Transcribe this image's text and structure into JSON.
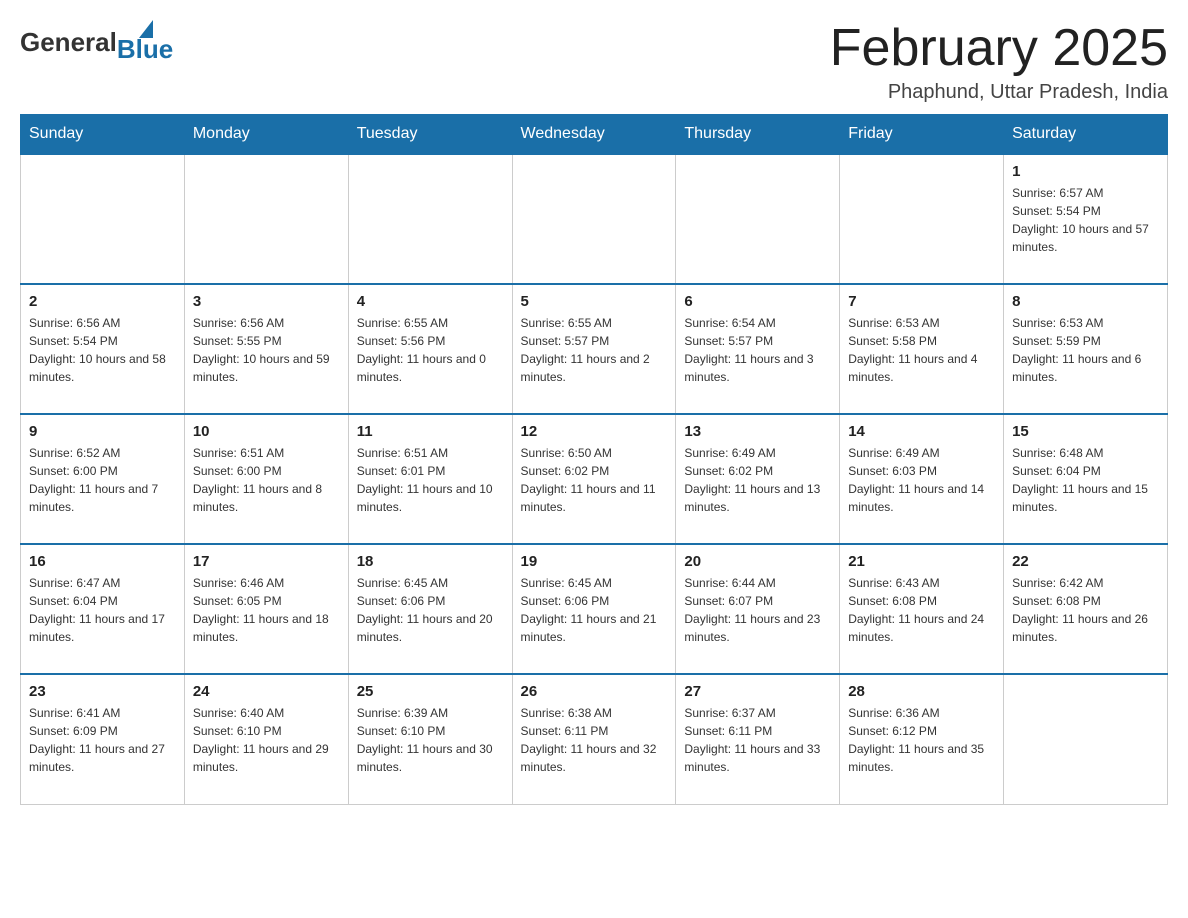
{
  "logo": {
    "general": "General",
    "blue": "Blue"
  },
  "title": {
    "month_year": "February 2025",
    "location": "Phaphund, Uttar Pradesh, India"
  },
  "days_of_week": [
    "Sunday",
    "Monday",
    "Tuesday",
    "Wednesday",
    "Thursday",
    "Friday",
    "Saturday"
  ],
  "weeks": [
    [
      {
        "day": "",
        "sunrise": "",
        "sunset": "",
        "daylight": ""
      },
      {
        "day": "",
        "sunrise": "",
        "sunset": "",
        "daylight": ""
      },
      {
        "day": "",
        "sunrise": "",
        "sunset": "",
        "daylight": ""
      },
      {
        "day": "",
        "sunrise": "",
        "sunset": "",
        "daylight": ""
      },
      {
        "day": "",
        "sunrise": "",
        "sunset": "",
        "daylight": ""
      },
      {
        "day": "",
        "sunrise": "",
        "sunset": "",
        "daylight": ""
      },
      {
        "day": "1",
        "sunrise": "Sunrise: 6:57 AM",
        "sunset": "Sunset: 5:54 PM",
        "daylight": "Daylight: 10 hours and 57 minutes."
      }
    ],
    [
      {
        "day": "2",
        "sunrise": "Sunrise: 6:56 AM",
        "sunset": "Sunset: 5:54 PM",
        "daylight": "Daylight: 10 hours and 58 minutes."
      },
      {
        "day": "3",
        "sunrise": "Sunrise: 6:56 AM",
        "sunset": "Sunset: 5:55 PM",
        "daylight": "Daylight: 10 hours and 59 minutes."
      },
      {
        "day": "4",
        "sunrise": "Sunrise: 6:55 AM",
        "sunset": "Sunset: 5:56 PM",
        "daylight": "Daylight: 11 hours and 0 minutes."
      },
      {
        "day": "5",
        "sunrise": "Sunrise: 6:55 AM",
        "sunset": "Sunset: 5:57 PM",
        "daylight": "Daylight: 11 hours and 2 minutes."
      },
      {
        "day": "6",
        "sunrise": "Sunrise: 6:54 AM",
        "sunset": "Sunset: 5:57 PM",
        "daylight": "Daylight: 11 hours and 3 minutes."
      },
      {
        "day": "7",
        "sunrise": "Sunrise: 6:53 AM",
        "sunset": "Sunset: 5:58 PM",
        "daylight": "Daylight: 11 hours and 4 minutes."
      },
      {
        "day": "8",
        "sunrise": "Sunrise: 6:53 AM",
        "sunset": "Sunset: 5:59 PM",
        "daylight": "Daylight: 11 hours and 6 minutes."
      }
    ],
    [
      {
        "day": "9",
        "sunrise": "Sunrise: 6:52 AM",
        "sunset": "Sunset: 6:00 PM",
        "daylight": "Daylight: 11 hours and 7 minutes."
      },
      {
        "day": "10",
        "sunrise": "Sunrise: 6:51 AM",
        "sunset": "Sunset: 6:00 PM",
        "daylight": "Daylight: 11 hours and 8 minutes."
      },
      {
        "day": "11",
        "sunrise": "Sunrise: 6:51 AM",
        "sunset": "Sunset: 6:01 PM",
        "daylight": "Daylight: 11 hours and 10 minutes."
      },
      {
        "day": "12",
        "sunrise": "Sunrise: 6:50 AM",
        "sunset": "Sunset: 6:02 PM",
        "daylight": "Daylight: 11 hours and 11 minutes."
      },
      {
        "day": "13",
        "sunrise": "Sunrise: 6:49 AM",
        "sunset": "Sunset: 6:02 PM",
        "daylight": "Daylight: 11 hours and 13 minutes."
      },
      {
        "day": "14",
        "sunrise": "Sunrise: 6:49 AM",
        "sunset": "Sunset: 6:03 PM",
        "daylight": "Daylight: 11 hours and 14 minutes."
      },
      {
        "day": "15",
        "sunrise": "Sunrise: 6:48 AM",
        "sunset": "Sunset: 6:04 PM",
        "daylight": "Daylight: 11 hours and 15 minutes."
      }
    ],
    [
      {
        "day": "16",
        "sunrise": "Sunrise: 6:47 AM",
        "sunset": "Sunset: 6:04 PM",
        "daylight": "Daylight: 11 hours and 17 minutes."
      },
      {
        "day": "17",
        "sunrise": "Sunrise: 6:46 AM",
        "sunset": "Sunset: 6:05 PM",
        "daylight": "Daylight: 11 hours and 18 minutes."
      },
      {
        "day": "18",
        "sunrise": "Sunrise: 6:45 AM",
        "sunset": "Sunset: 6:06 PM",
        "daylight": "Daylight: 11 hours and 20 minutes."
      },
      {
        "day": "19",
        "sunrise": "Sunrise: 6:45 AM",
        "sunset": "Sunset: 6:06 PM",
        "daylight": "Daylight: 11 hours and 21 minutes."
      },
      {
        "day": "20",
        "sunrise": "Sunrise: 6:44 AM",
        "sunset": "Sunset: 6:07 PM",
        "daylight": "Daylight: 11 hours and 23 minutes."
      },
      {
        "day": "21",
        "sunrise": "Sunrise: 6:43 AM",
        "sunset": "Sunset: 6:08 PM",
        "daylight": "Daylight: 11 hours and 24 minutes."
      },
      {
        "day": "22",
        "sunrise": "Sunrise: 6:42 AM",
        "sunset": "Sunset: 6:08 PM",
        "daylight": "Daylight: 11 hours and 26 minutes."
      }
    ],
    [
      {
        "day": "23",
        "sunrise": "Sunrise: 6:41 AM",
        "sunset": "Sunset: 6:09 PM",
        "daylight": "Daylight: 11 hours and 27 minutes."
      },
      {
        "day": "24",
        "sunrise": "Sunrise: 6:40 AM",
        "sunset": "Sunset: 6:10 PM",
        "daylight": "Daylight: 11 hours and 29 minutes."
      },
      {
        "day": "25",
        "sunrise": "Sunrise: 6:39 AM",
        "sunset": "Sunset: 6:10 PM",
        "daylight": "Daylight: 11 hours and 30 minutes."
      },
      {
        "day": "26",
        "sunrise": "Sunrise: 6:38 AM",
        "sunset": "Sunset: 6:11 PM",
        "daylight": "Daylight: 11 hours and 32 minutes."
      },
      {
        "day": "27",
        "sunrise": "Sunrise: 6:37 AM",
        "sunset": "Sunset: 6:11 PM",
        "daylight": "Daylight: 11 hours and 33 minutes."
      },
      {
        "day": "28",
        "sunrise": "Sunrise: 6:36 AM",
        "sunset": "Sunset: 6:12 PM",
        "daylight": "Daylight: 11 hours and 35 minutes."
      },
      {
        "day": "",
        "sunrise": "",
        "sunset": "",
        "daylight": ""
      }
    ]
  ]
}
